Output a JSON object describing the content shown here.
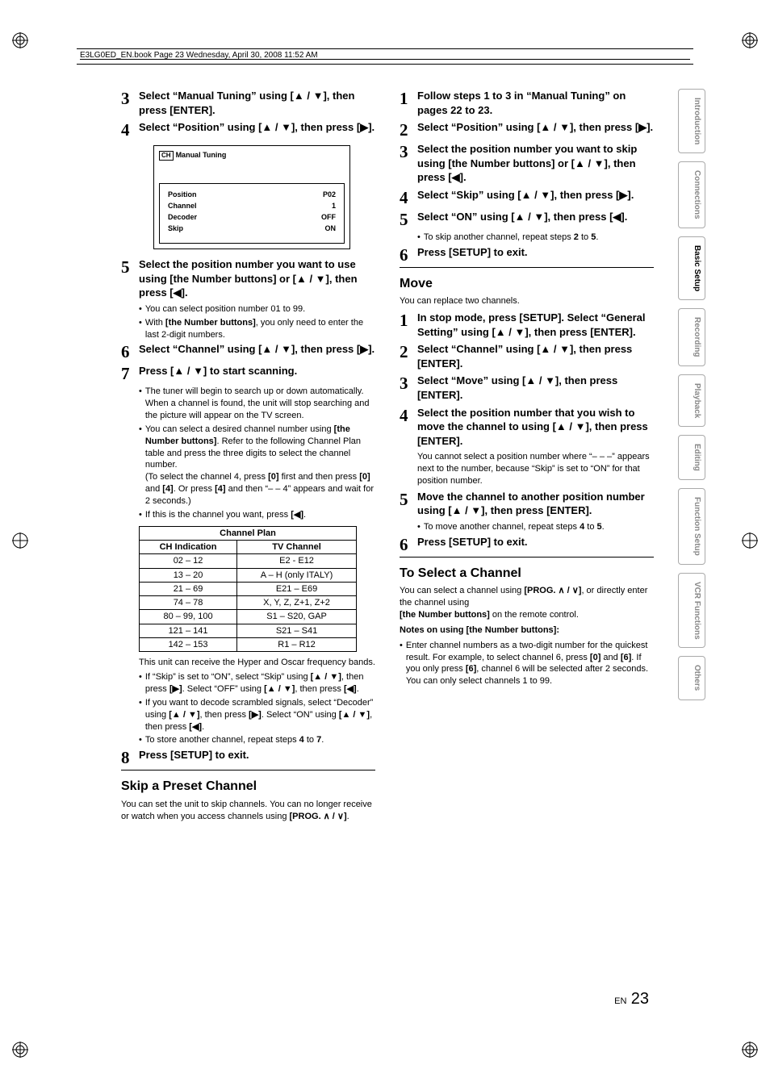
{
  "header": "E3LG0ED_EN.book  Page 23  Wednesday, April 30, 2008  11:52 AM",
  "footer": {
    "lang": "EN",
    "page": "23"
  },
  "tabs": [
    "Introduction",
    "Connections",
    "Basic Setup",
    "Recording",
    "Playback",
    "Editing",
    "Function Setup",
    "VCR Functions",
    "Others"
  ],
  "active_tab": "Basic Setup",
  "left": {
    "s3": "Select “Manual Tuning” using [▲ / ▼], then press [ENTER].",
    "s4": "Select “Position” using [▲ / ▼], then press [▶].",
    "osd": {
      "title": "Manual Tuning",
      "rows": [
        {
          "k": "Position",
          "v": "P02"
        },
        {
          "k": "Channel",
          "v": "1"
        },
        {
          "k": "Decoder",
          "v": "OFF"
        },
        {
          "k": "Skip",
          "v": "ON"
        }
      ]
    },
    "s5": "Select the position number you want to use using [the Number buttons] or [▲ / ▼], then press [◀].",
    "s5b1": "You can select position number 01 to 99.",
    "s5b2a": "With ",
    "s5b2b": "[the Number buttons]",
    "s5b2c": ", you only need to enter the last 2-digit numbers.",
    "s6": "Select “Channel” using [▲ / ▼], then press [▶].",
    "s7": "Press [▲ / ▼] to start scanning.",
    "s7b1": "The tuner will begin to search up or down automatically. When a channel is found, the unit will stop searching and the picture will appear on the TV screen.",
    "s7b2a": "You can select a desired channel number using ",
    "s7b2b": "[the Number buttons]",
    "s7b2c": ". Refer to the following Channel Plan table and press the three digits to select the channel number.",
    "s7b2d": "(To select the channel 4, press ",
    "s7b2e": "[0]",
    "s7b2f": " first and then press ",
    "s7b2g": "[0]",
    "s7b2h": " and ",
    "s7b2i": "[4]",
    "s7b2j": ". Or press ",
    "s7b2k": "[4]",
    "s7b2l": " and then “– – 4” appears and wait for 2 seconds.)",
    "s7b3a": "If this is the channel you want, press ",
    "s7b3b": "[◀]",
    "s7b3c": ".",
    "table": {
      "title": "Channel Plan",
      "h1": "CH Indication",
      "h2": "TV Channel",
      "rows": [
        {
          "a": "02 – 12",
          "b": "E2 - E12"
        },
        {
          "a": "13 – 20",
          "b": "A – H (only ITALY)"
        },
        {
          "a": "21 – 69",
          "b": "E21 – E69"
        },
        {
          "a": "74 – 78",
          "b": "X, Y, Z, Z+1, Z+2"
        },
        {
          "a": "80 – 99, 100",
          "b": "S1 – S20, GAP"
        },
        {
          "a": "121 – 141",
          "b": "S21 – S41"
        },
        {
          "a": "142 – 153",
          "b": "R1 – R12"
        }
      ]
    },
    "note1": "This unit can receive the Hyper and Oscar frequency bands.",
    "note2a": "If “Skip” is set to “ON”, select “Skip” using ",
    "note2b": "[▲ / ▼]",
    "note2c": ", then press ",
    "note2d": "[▶]",
    "note2e": ". Select “OFF” using ",
    "note2f": "[▲ / ▼]",
    "note2g": ", then press ",
    "note2h": "[◀]",
    "note2i": ".",
    "note3a": "If you want to decode scrambled signals, select “Decoder” using ",
    "note3b": "[▲ / ▼]",
    "note3c": ", then press ",
    "note3d": "[▶]",
    "note3e": ". Select “ON” using ",
    "note3f": "[▲ / ▼]",
    "note3g": ", then press ",
    "note3h": "[◀]",
    "note3i": ".",
    "note4a": "To store another channel, repeat steps ",
    "note4b": "4",
    "note4c": " to ",
    "note4d": "7",
    "note4e": ".",
    "s8": "Press [SETUP] to exit.",
    "h_skip": "Skip a Preset Channel",
    "skip_a": "You can set the unit to skip channels. You can no longer receive or watch when you access channels using ",
    "skip_b": "[PROG. ∧ / ∨]",
    "skip_c": "."
  },
  "right": {
    "s1": "Follow steps 1 to 3 in “Manual Tuning” on pages 22 to 23.",
    "s2": "Select “Position” using [▲ / ▼], then press [▶].",
    "s3": "Select the position number you want to skip using [the Number buttons] or [▲ / ▼], then press [◀].",
    "s4": "Select “Skip” using [▲ / ▼], then press [▶].",
    "s5": "Select “ON” using [▲ / ▼], then press [◀].",
    "s5b_a": "To skip another channel, repeat steps ",
    "s5b_b": "2",
    "s5b_c": " to ",
    "s5b_d": "5",
    "s5b_e": ".",
    "s6": "Press [SETUP] to exit.",
    "h_move": "Move",
    "move_intro": "You can replace two channels.",
    "m1": "In stop mode, press [SETUP]. Select “General Setting” using [▲ / ▼], then press [ENTER].",
    "m2": "Select “Channel” using [▲ / ▼], then press [ENTER].",
    "m3": "Select “Move” using [▲ / ▼], then press [ENTER].",
    "m4": "Select the position number that you wish to move the channel to using [▲ / ▼], then press [ENTER].",
    "m4b": "You cannot select a position number where “– – –” appears next to the number, because “Skip” is set to “ON” for that position number.",
    "m5": "Move the channel to another position number using [▲ / ▼], then press [ENTER].",
    "m5b_a": "To move another channel, repeat steps ",
    "m5b_b": "4",
    "m5b_c": " to ",
    "m5b_d": "5",
    "m5b_e": ".",
    "m6": "Press [SETUP] to exit.",
    "h_select": "To Select a Channel",
    "sel_a": "You can select a channel using ",
    "sel_b": "[PROG. ∧ / ∨]",
    "sel_c": ", or directly enter the channel using ",
    "sel_d": "[the Number buttons]",
    "sel_e": " on the remote control.",
    "notes_h": "Notes on using [the Number buttons]:",
    "notes_a": "Enter channel numbers as a two-digit number for the quickest result. For example, to select channel 6, press ",
    "notes_b": "[0]",
    "notes_c": " and ",
    "notes_d": "[6]",
    "notes_e": ". If you only press ",
    "notes_f": "[6]",
    "notes_g": ", channel 6 will be selected after 2 seconds. You can only select channels 1 to 99."
  }
}
